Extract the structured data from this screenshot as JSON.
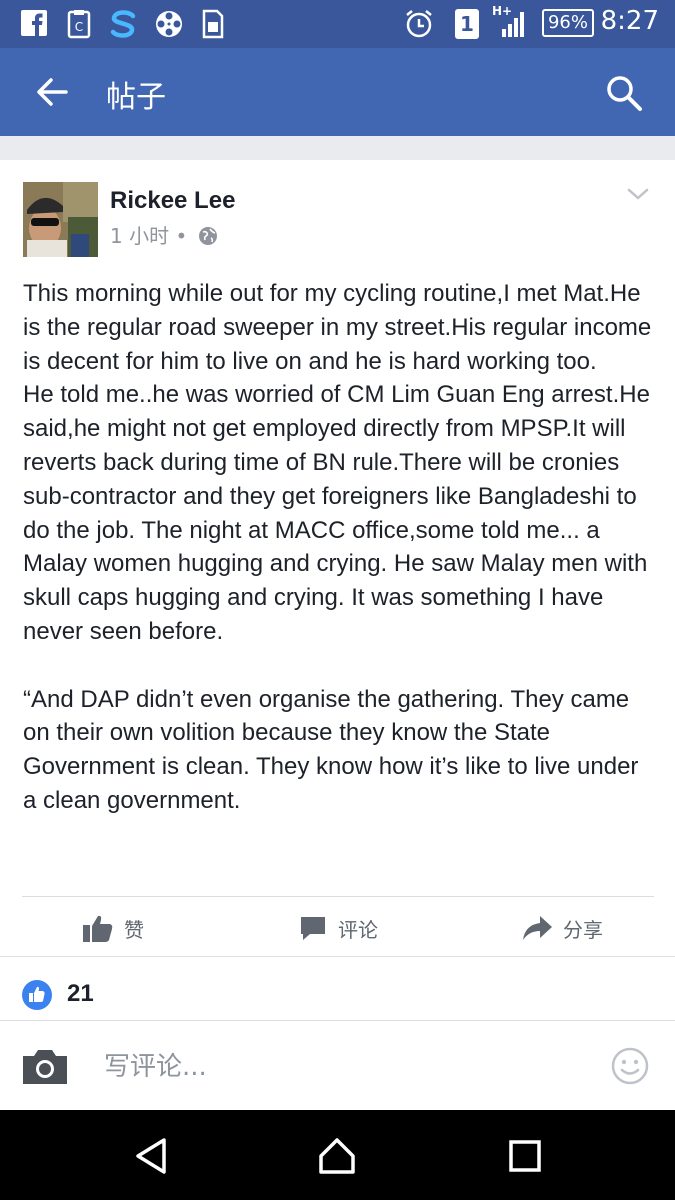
{
  "status_bar": {
    "time": "8:27",
    "battery": "96%",
    "sim_slot": "1",
    "network": "H+",
    "icons": [
      "facebook-icon",
      "clipboard-icon",
      "s-app-icon",
      "film-reel-icon",
      "sim-card-icon",
      "alarm-icon",
      "sim-1-icon",
      "signal-icon",
      "battery-icon"
    ]
  },
  "app_bar": {
    "title": "帖子",
    "back_icon": "arrow-left-icon",
    "search_icon": "search-icon"
  },
  "post": {
    "author": "Rickee Lee",
    "time": "1 小时 •",
    "privacy_icon": "globe-icon",
    "menu_icon": "chevron-down-icon",
    "body": "This morning while out for my cycling routine,I met Mat.He is the regular road sweeper in my street.His regular income is decent for him to live on and he is hard working too.\nHe told me..he was worried of CM Lim Guan Eng arrest.He said,he might not get employed directly from MPSP.It will reverts back during time of BN rule.There will be cronies sub-contractor and they get foreigners like Bangladeshi to do the job. The night at MACC office,some told me... a Malay women hugging and crying. He saw Malay men with skull caps hugging and crying. It was something I have never seen before.\n\n“And DAP didn’t even organise the gathering. They came on their own volition because they know the State Government is clean. They know how it’s like to live under a clean government.",
    "actions": {
      "like": "赞",
      "comment": "评论",
      "share": "分享"
    },
    "like_count": "21"
  },
  "comment_bar": {
    "placeholder": "写评论...",
    "camera_icon": "camera-icon",
    "emoji_icon": "smiley-icon"
  },
  "nav_bar": {
    "icons": [
      "back-triangle-icon",
      "home-icon",
      "recents-icon"
    ]
  },
  "colors": {
    "status_bar": "#39579a",
    "app_bar": "#4267b2",
    "like_blue": "#3b82f0"
  }
}
